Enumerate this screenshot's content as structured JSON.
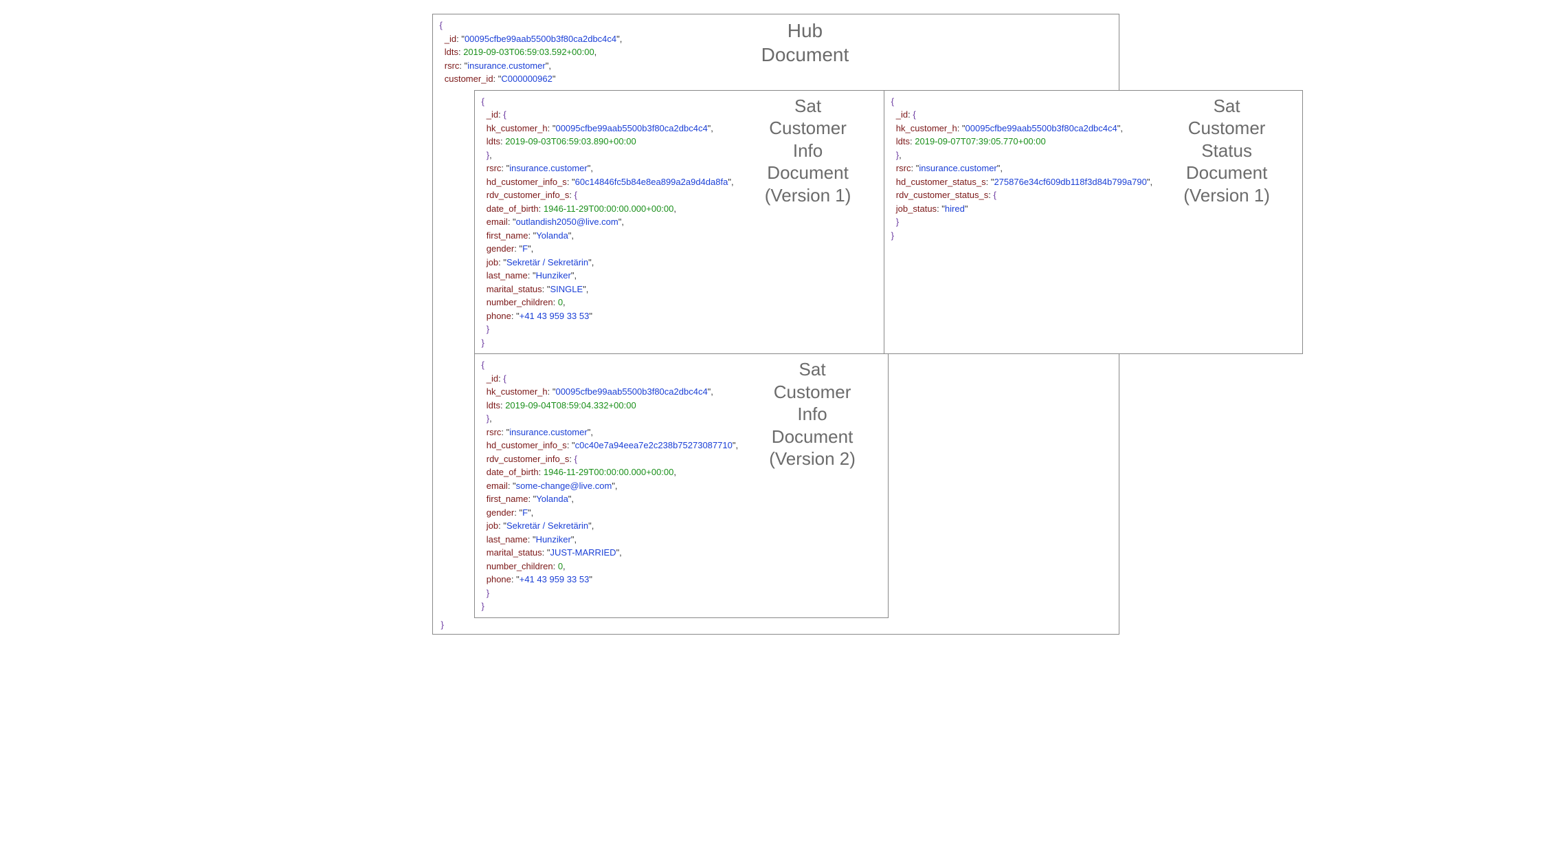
{
  "hub": {
    "title": "Hub\nDocument",
    "_id": "00095cfbe99aab5500b3f80ca2dbc4c4",
    "ldts": "2019-09-03T06:59:03.592+00:00",
    "rsrc": "insurance.customer",
    "customer_id": "C000000962"
  },
  "sat_info_v1": {
    "title": "Sat\nCustomer\nInfo\nDocument\n(Version 1)",
    "hk_customer_h": "00095cfbe99aab5500b3f80ca2dbc4c4",
    "ldts": "2019-09-03T06:59:03.890+00:00",
    "rsrc": "insurance.customer",
    "hd_customer_info_s": "60c14846fc5b84e8ea899a2a9d4da8fa",
    "date_of_birth": "1946-11-29T00:00:00.000+00:00",
    "email": "outlandish2050@live.com",
    "first_name": "Yolanda",
    "gender": "F",
    "job": "Sekretär / Sekretärin",
    "last_name": "Hunziker",
    "marital_status": "SINGLE",
    "number_children": "0",
    "phone": "+41 43 959 33 53"
  },
  "sat_status_v1": {
    "title": "Sat\nCustomer\nStatus\nDocument\n(Version 1)",
    "hk_customer_h": "00095cfbe99aab5500b3f80ca2dbc4c4",
    "ldts": "2019-09-07T07:39:05.770+00:00",
    "rsrc": "insurance.customer",
    "hd_customer_status_s": "275876e34cf609db118f3d84b799a790",
    "job_status": "hired"
  },
  "sat_info_v2": {
    "title": "Sat\nCustomer\nInfo\nDocument\n(Version 2)",
    "hk_customer_h": "00095cfbe99aab5500b3f80ca2dbc4c4",
    "ldts": "2019-09-04T08:59:04.332+00:00",
    "rsrc": "insurance.customer",
    "hd_customer_info_s": "c0c40e7a94eea7e2c238b75273087710",
    "date_of_birth": "1946-11-29T00:00:00.000+00:00",
    "email": "some-change@live.com",
    "first_name": "Yolanda",
    "gender": "F",
    "job": "Sekretär / Sekretärin",
    "last_name": "Hunziker",
    "marital_status": "JUST-MARRIED",
    "number_children": "0",
    "phone": "+41 43 959 33 53"
  }
}
